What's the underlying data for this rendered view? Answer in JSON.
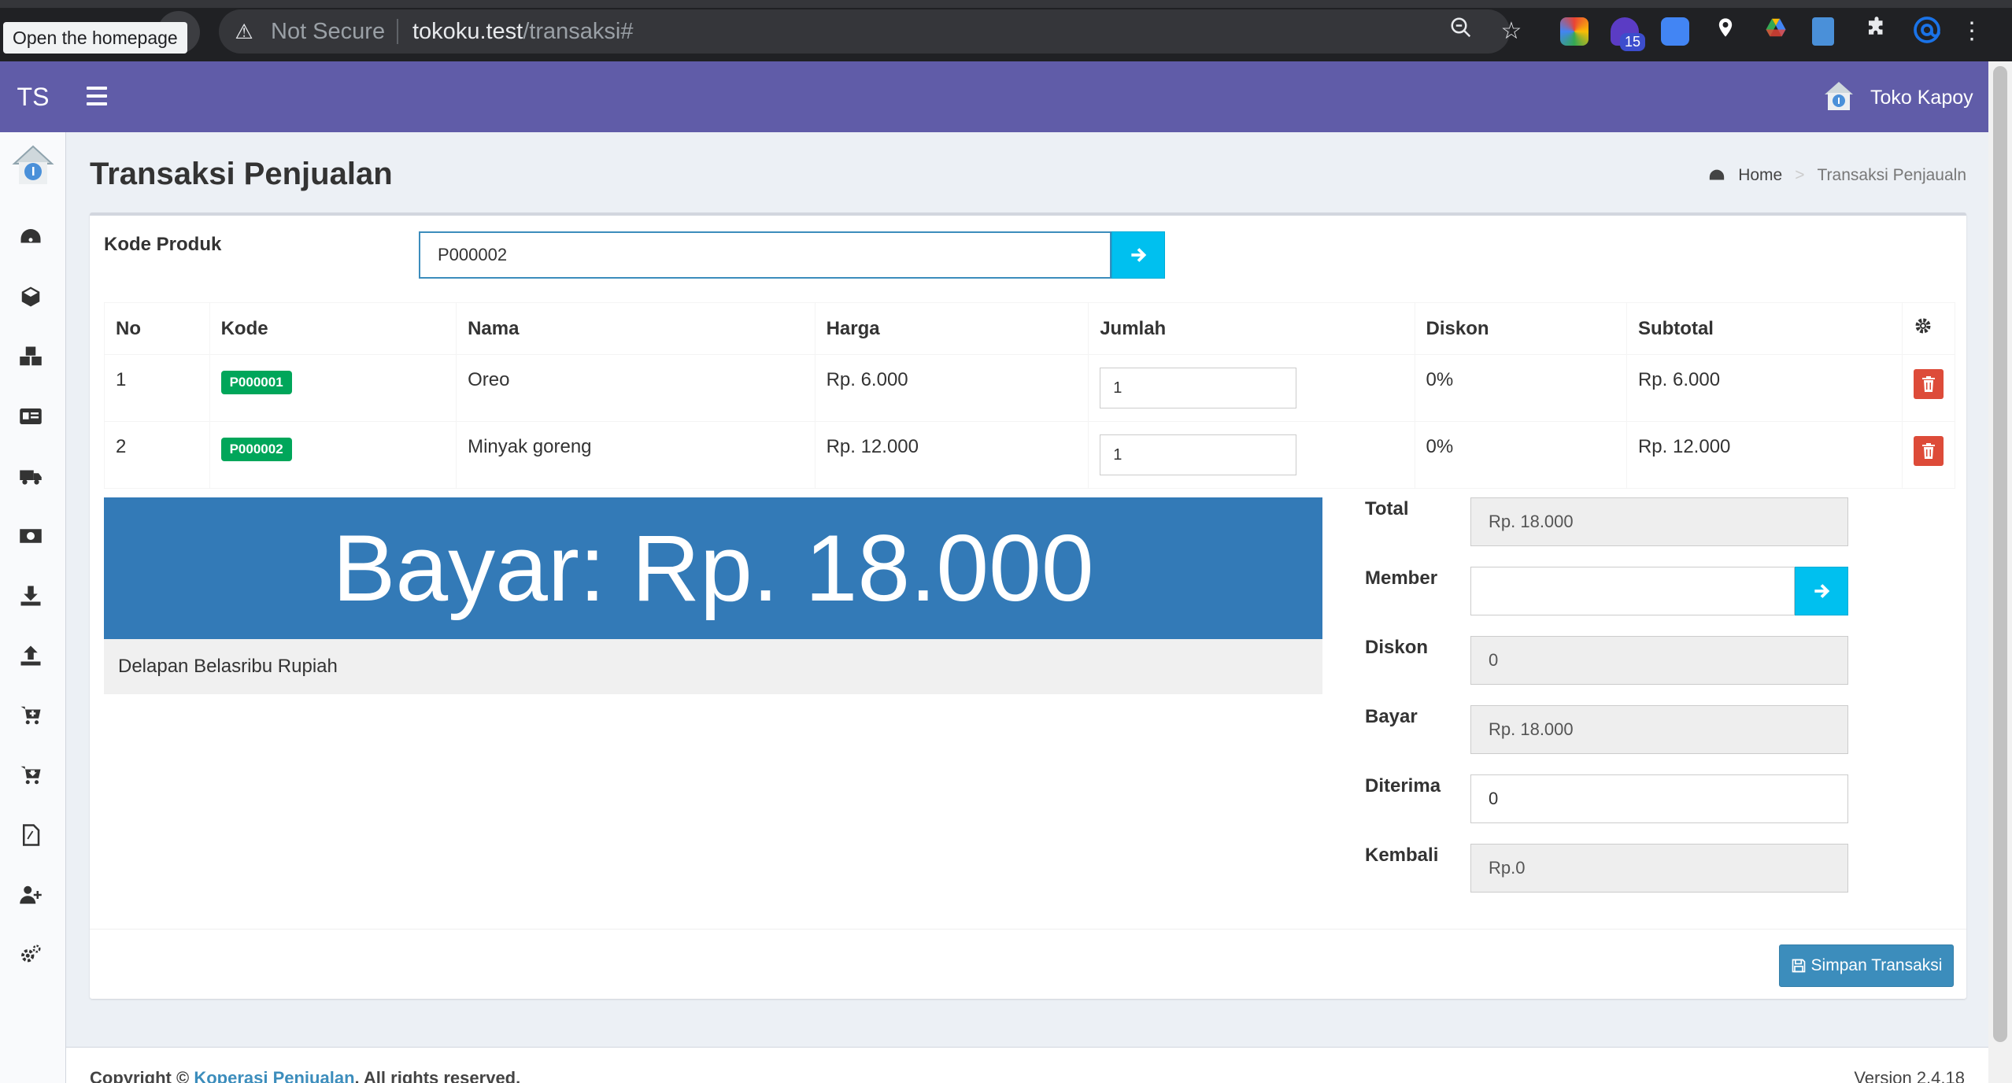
{
  "browser": {
    "tooltip": "Open the homepage",
    "security_label": "Not Secure",
    "url_host": "tokoku.test",
    "url_path": "/transaksi#",
    "extension_badge": "15"
  },
  "header": {
    "logo_mini": "TS",
    "store_name": "Toko Kapoy"
  },
  "page": {
    "title": "Transaksi Penjualan",
    "breadcrumb": {
      "home": "Home",
      "current": "Transaksi Penjaualn"
    }
  },
  "form": {
    "kode_label": "Kode Produk",
    "kode_value": "P000002"
  },
  "table": {
    "headers": [
      "No",
      "Kode",
      "Nama",
      "Harga",
      "Jumlah",
      "Diskon",
      "Subtotal"
    ],
    "rows": [
      {
        "no": "1",
        "kode": "P000001",
        "nama": "Oreo",
        "harga": "Rp. 6.000",
        "jumlah": "1",
        "diskon": "0%",
        "subtotal": "Rp. 6.000"
      },
      {
        "no": "2",
        "kode": "P000002",
        "nama": "Minyak goreng",
        "harga": "Rp. 12.000",
        "jumlah": "1",
        "diskon": "0%",
        "subtotal": "Rp. 12.000"
      }
    ]
  },
  "summary": {
    "bayar_display": "Bayar: Rp. 18.000",
    "terbilang": "Delapan Belasribu Rupiah",
    "total_label": "Total",
    "total_value": "Rp. 18.000",
    "member_label": "Member",
    "member_value": "",
    "diskon_label": "Diskon",
    "diskon_value": "0",
    "bayar_label": "Bayar",
    "bayar_value": "Rp. 18.000",
    "diterima_label": "Diterima",
    "diterima_value": "0",
    "kembali_label": "Kembali",
    "kembali_value": "Rp.0"
  },
  "actions": {
    "save_label": "Simpan Transaksi"
  },
  "footer": {
    "copyright_prefix": "Copyright ©",
    "copyright_link": "Koperasi Penjualan",
    "copyright_suffix": ". All rights reserved.",
    "version": "Version 2.4.18"
  },
  "colors": {
    "header": "#605ca8",
    "primary": "#3c8dbc",
    "info": "#00c0ef",
    "success": "#00a65a",
    "danger": "#dd4b39",
    "bayar_box": "#337ab7"
  }
}
